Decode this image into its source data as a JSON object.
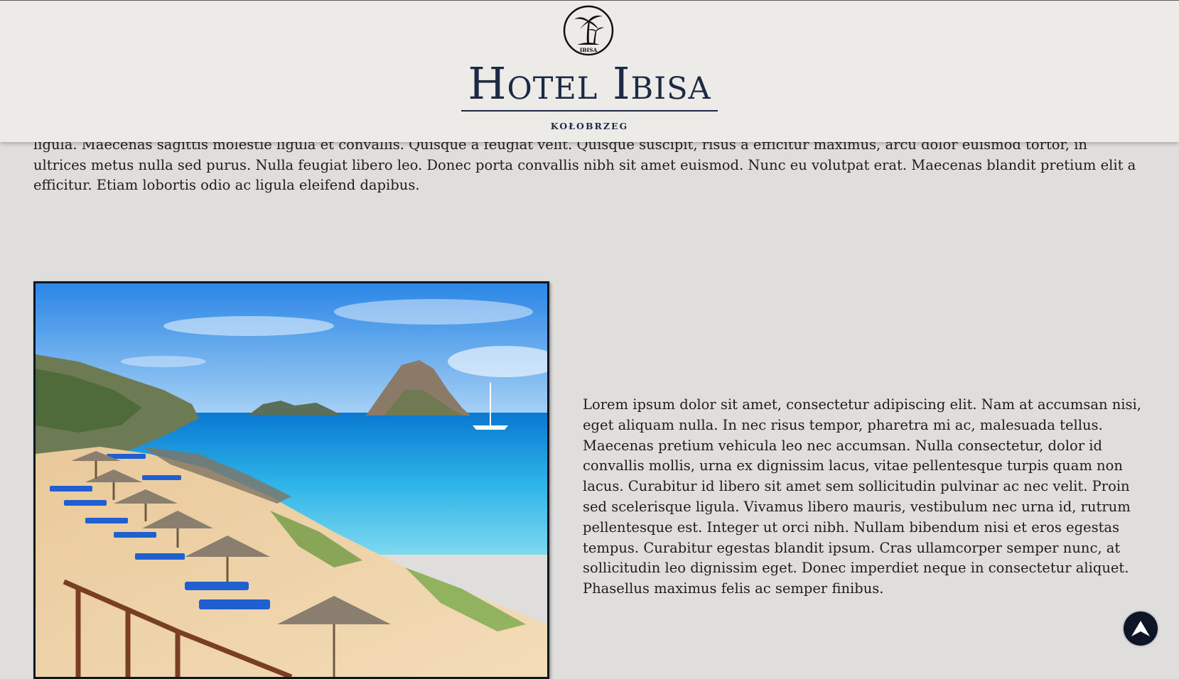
{
  "header": {
    "logo_icon": "palm-tree-emblem-icon",
    "logo_text": "IBISA",
    "brand_name": "Hotel Ibisa",
    "city": "KOŁOBRZEG"
  },
  "content": {
    "top_paragraph": "ligula. Maecenas sagittis molestie ligula et convallis. Quisque a feugiat velit. Quisque suscipit, risus a efficitur maximus, arcu dolor euismod tortor, in ultrices metus nulla sed purus. Nulla feugiat libero leo. Donec porta convallis nibh sit amet euismod. Nunc eu volutpat erat. Maecenas blandit pretium elit a efficitur. Etiam lobortis odio ac ligula eleifend dapibus.",
    "image_icon": "beach-photo",
    "side_paragraph": "Lorem ipsum dolor sit amet, consectetur adipiscing elit. Nam at accumsan nisi, eget aliquam nulla. In nec risus tempor, pharetra mi ac, malesuada tellus. Maecenas pretium vehicula leo nec accumsan. Nulla consectetur, dolor id convallis mollis, urna ex dignissim lacus, vitae pellentesque turpis quam non lacus. Curabitur id libero sit amet sem sollicitudin pulvinar ac nec velit. Proin sed scelerisque ligula. Vivamus libero mauris, vestibulum nec urna id, rutrum pellentesque est. Integer ut orci nibh. Nullam bibendum nisi et eros egestas tempus. Curabitur egestas blandit ipsum. Cras ullamcorper semper nunc, at sollicitudin leo dignissim eget. Donec imperdiet neque in consectetur aliquet. Phasellus maximus felis ac semper finibus."
  },
  "controls": {
    "scroll_top_icon": "arrow-up-icon"
  },
  "colors": {
    "header_bg": "#edebe8",
    "page_bg": "#e0dedc",
    "brand_navy": "#1d2a44",
    "button_bg": "#0e1526"
  }
}
